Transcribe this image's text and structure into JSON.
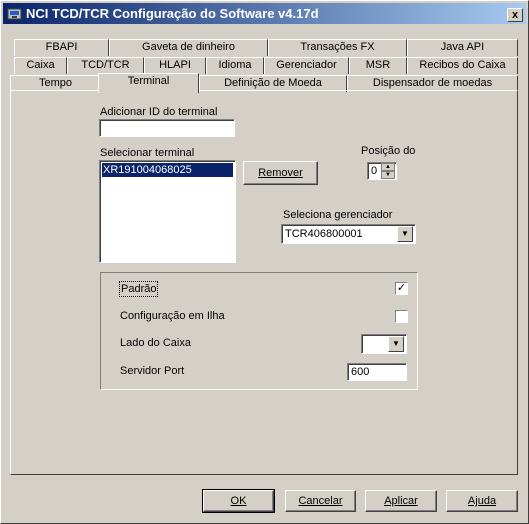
{
  "window": {
    "title": "NCI TCD/TCR Configuração do Software v4.17d",
    "close_label": "x"
  },
  "tabs": {
    "row1": [
      "FBAPI",
      "Gaveta de dinheiro",
      "Transações FX",
      "Java API"
    ],
    "row2": [
      "Caixa",
      "TCD/TCR",
      "HLAPI",
      "Idioma",
      "Gerenciador",
      "MSR",
      "Recibos do Caixa"
    ],
    "row3": [
      "Tempo",
      "Terminal",
      "Definição de Moeda",
      "Dispensador de moedas"
    ],
    "active": "Terminal"
  },
  "terminal": {
    "add_label": "Adicionar ID do terminal",
    "add_value": "",
    "select_label": "Selecionar terminal",
    "terminals": [
      "XR191004068025"
    ],
    "selected_index": 0,
    "remove_button": "Remover",
    "position_label": "Posição do",
    "position_value": "0",
    "manager_label": "Seleciona gerenciador",
    "manager_value": "TCR406800001"
  },
  "options": {
    "default_label": "Padrão",
    "default_checked": true,
    "island_label": "Configuração em Ilha",
    "island_checked": false,
    "side_label": "Lado do Caixa",
    "side_value": "",
    "port_label": "Servidor Port",
    "port_value": "600"
  },
  "footer": {
    "ok": "OK",
    "cancel": "Cancelar",
    "apply": "Aplicar",
    "help": "Ajuda"
  }
}
